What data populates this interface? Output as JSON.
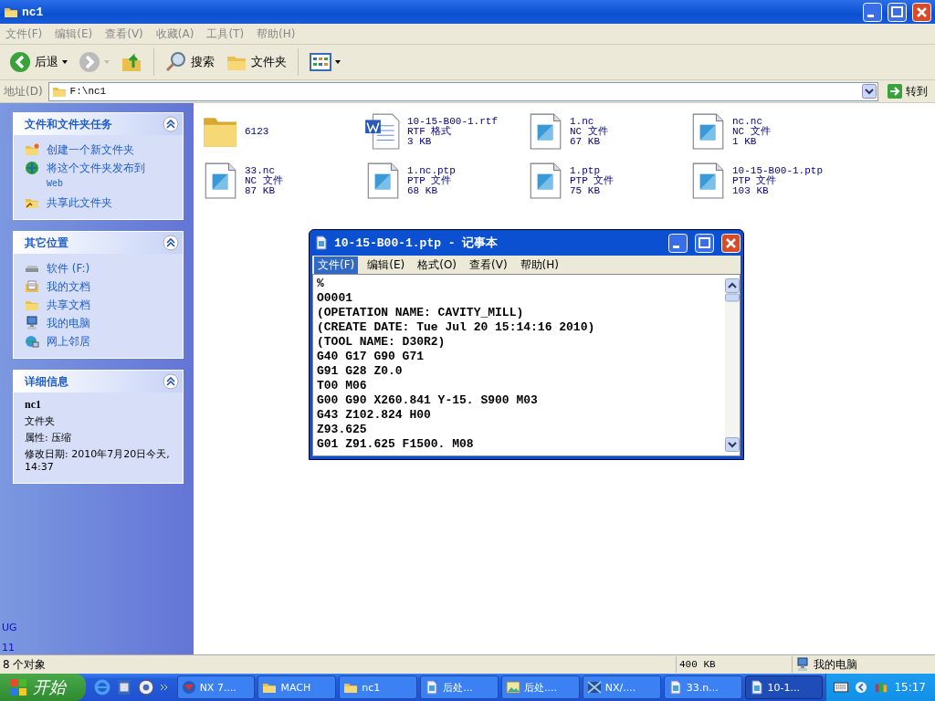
{
  "window": {
    "title": "nc1"
  },
  "menu": [
    {
      "label": "文件(F)"
    },
    {
      "label": "编辑(E)"
    },
    {
      "label": "查看(V)"
    },
    {
      "label": "收藏(A)"
    },
    {
      "label": "工具(T)"
    },
    {
      "label": "帮助(H)"
    }
  ],
  "toolbar": [
    {
      "kind": "back",
      "label": "后退",
      "disabled": false
    },
    {
      "kind": "forward",
      "disabled": true
    },
    {
      "kind": "up"
    },
    {
      "kind": "search",
      "label": "搜索"
    },
    {
      "kind": "folders",
      "label": "文件夹"
    },
    {
      "kind": "views"
    }
  ],
  "address": {
    "label": "地址(D)",
    "value": "F:\\nc1",
    "go": "转到"
  },
  "sidebar": {
    "panels": [
      {
        "title": "文件和文件夹任务",
        "expanded": true,
        "items": [
          {
            "kind": "newfolder",
            "label": "创建一个新文件夹"
          },
          {
            "kind": "web",
            "label": "将这个文件夹发布到",
            "sub": "Web"
          },
          {
            "kind": "share",
            "label": "共享此文件夹"
          }
        ]
      },
      {
        "title": "其它位置",
        "expanded": true,
        "items": [
          {
            "kind": "drive",
            "label": "软件 (F:)"
          },
          {
            "kind": "docs",
            "label": "我的文档"
          },
          {
            "kind": "folder",
            "label": "共享文档"
          },
          {
            "kind": "computer",
            "label": "我的电脑"
          },
          {
            "kind": "network",
            "label": "网上邻居"
          }
        ]
      },
      {
        "title": "详细信息",
        "expanded": true,
        "details": {
          "name": "nc1",
          "type": "文件夹",
          "lines": [
            "属性: 压缩",
            "修改日期: 2010年7月20日今天, 14:37"
          ]
        }
      }
    ],
    "footer": [
      "UG",
      "11"
    ]
  },
  "files": [
    {
      "kind": "folder",
      "name": "6123"
    },
    {
      "kind": "word",
      "name": "10-15-B00-1.rtf",
      "type": "RTF 格式",
      "size": "3 KB"
    },
    {
      "kind": "file",
      "name": "1.nc",
      "type": "NC 文件",
      "size": "67 KB"
    },
    {
      "kind": "file",
      "name": "nc.nc",
      "type": "NC 文件",
      "size": "1 KB"
    },
    {
      "kind": "file",
      "name": "33.nc",
      "type": "NC 文件",
      "size": "87 KB"
    },
    {
      "kind": "file",
      "name": "1.nc.ptp",
      "type": "PTP 文件",
      "size": "68 KB"
    },
    {
      "kind": "file",
      "name": "1.ptp",
      "type": "PTP 文件",
      "size": "75 KB"
    },
    {
      "kind": "file",
      "name": "10-15-B00-1.ptp",
      "type": "PTP 文件",
      "size": "103 KB"
    }
  ],
  "status_bar": {
    "objects": "8 个对象",
    "size": "400 KB",
    "zone": "我的电脑"
  },
  "notepad": {
    "title": "10-15-B00-1.ptp - 记事本",
    "menu": [
      {
        "label": "文件(F)",
        "selected": true
      },
      {
        "label": "编辑(E)",
        "selected": false
      },
      {
        "label": "格式(O)",
        "selected": false
      },
      {
        "label": "查看(V)",
        "selected": false
      },
      {
        "label": "帮助(H)",
        "selected": false
      }
    ],
    "lines": [
      "%",
      "O0001",
      "(OPETATION NAME: CAVITY_MILL)",
      "(CREATE DATE: Tue Jul 20 15:14:16 2010)",
      "(TOOL NAME: D30R2)",
      "G40 G17 G90 G71",
      "G91 G28 Z0.0",
      "T00 M06",
      "G00 G90 X260.841 Y-15. S900 M03",
      "G43 Z102.824 H00",
      "Z93.625",
      "G01 Z91.625 F1500. M08"
    ]
  },
  "taskbar": {
    "start": "开始",
    "quick_launch": [
      {
        "kind": "browser"
      },
      {
        "kind": "media"
      },
      {
        "kind": "app"
      }
    ],
    "tasks": [
      {
        "kind": "nx",
        "label": "NX 7....",
        "selected": false
      },
      {
        "kind": "folder",
        "label": "MACH",
        "selected": false
      },
      {
        "kind": "folder",
        "label": "nc1",
        "selected": false
      },
      {
        "kind": "doc",
        "label": "后处...",
        "selected": false
      },
      {
        "kind": "pic",
        "label": "后处....",
        "selected": false
      },
      {
        "kind": "nx2",
        "label": "NX/....",
        "selected": false
      },
      {
        "kind": "doc",
        "label": "33.n...",
        "selected": false
      },
      {
        "kind": "doc",
        "label": "10-1...",
        "selected": true
      }
    ],
    "clock": "15:17"
  }
}
